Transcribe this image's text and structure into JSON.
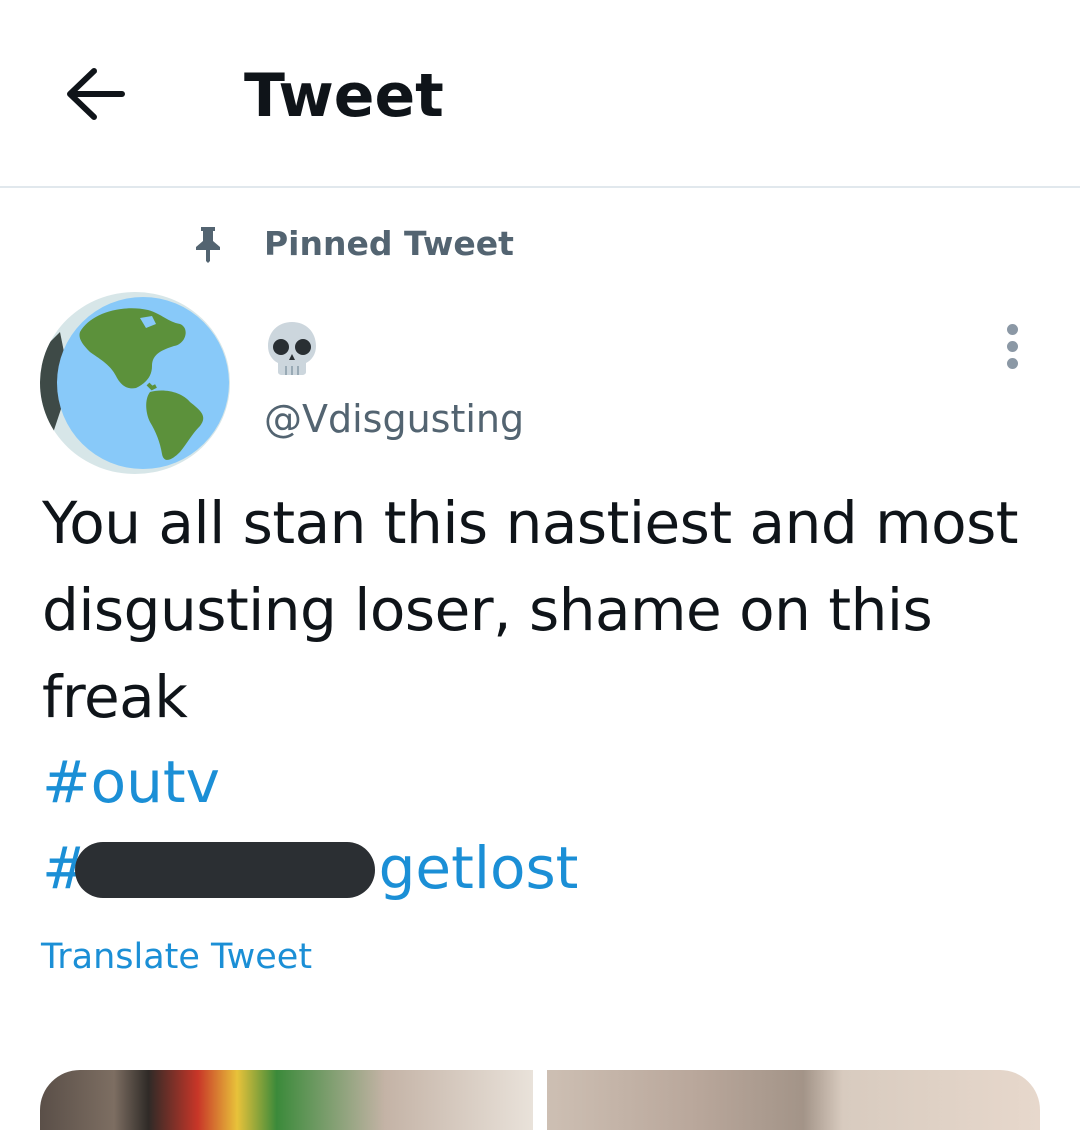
{
  "header": {
    "title": "Tweet",
    "back_icon": "arrow-left-icon"
  },
  "tweet": {
    "pinned_label": "Pinned Tweet",
    "pin_icon": "pin-icon",
    "display_name_emoji": "skull-icon",
    "handle": "@Vdisgusting",
    "text": "You all stan this nastiest and most disgusting loser, shame on this freak",
    "hashtags": [
      "#outv",
      "#",
      "getlost"
    ],
    "translate_label": "Translate Tweet",
    "more_icon": "more-vertical-icon"
  },
  "colors": {
    "link": "#1b8fd6",
    "secondary_text": "#536471",
    "primary_text": "#0f1419",
    "divider": "#e1e8ed"
  }
}
